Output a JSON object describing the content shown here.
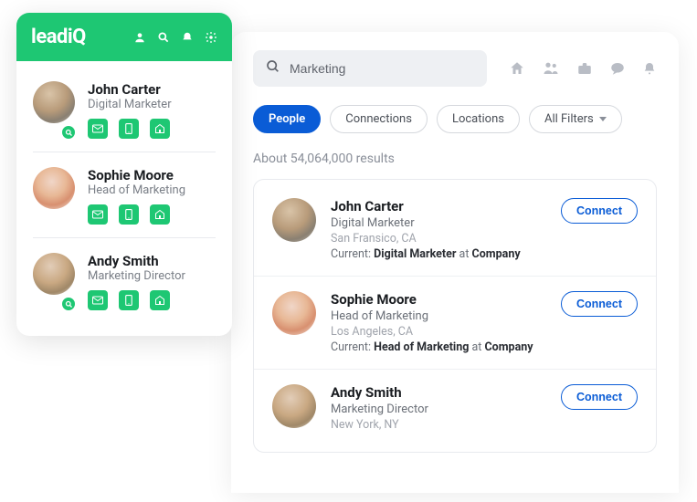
{
  "widget": {
    "brand": "leadiQ",
    "header_icons": [
      "person-icon",
      "search-icon",
      "bell-icon",
      "gear-icon"
    ],
    "items": [
      {
        "name": "John Carter",
        "title": "Digital Marketer",
        "badge": true
      },
      {
        "name": "Sophie Moore",
        "title": "Head of Marketing",
        "badge": false
      },
      {
        "name": "Andy Smith",
        "title": "Marketing Director",
        "badge": true
      }
    ],
    "action_icons": [
      "email-icon",
      "phone-icon",
      "building-icon"
    ]
  },
  "main": {
    "search_value": "Marketing",
    "nav_icons": [
      "home-icon",
      "people-icon",
      "briefcase-icon",
      "chat-icon",
      "bell-icon"
    ],
    "filters": [
      {
        "label": "People",
        "active": true
      },
      {
        "label": "Connections",
        "active": false
      },
      {
        "label": "Locations",
        "active": false
      },
      {
        "label": "All Filters",
        "active": false,
        "dropdown": true
      }
    ],
    "results_count": "About 54,064,000 results",
    "current_label": "Current:",
    "at_label": "at",
    "connect_label": "Connect",
    "results": [
      {
        "name": "John Carter",
        "title": "Digital Marketer",
        "location": "San Fransico, CA",
        "role": "Digital Marketer",
        "company": "Company"
      },
      {
        "name": "Sophie Moore",
        "title": "Head of Marketing",
        "location": "Los Angeles, CA",
        "role": "Head of Marketing",
        "company": "Company"
      },
      {
        "name": "Andy Smith",
        "title": "Marketing Director",
        "location": "New York, NY",
        "role": "",
        "company": ""
      }
    ]
  },
  "colors": {
    "brand_green": "#1ec773",
    "brand_blue": "#0a5cd6"
  }
}
